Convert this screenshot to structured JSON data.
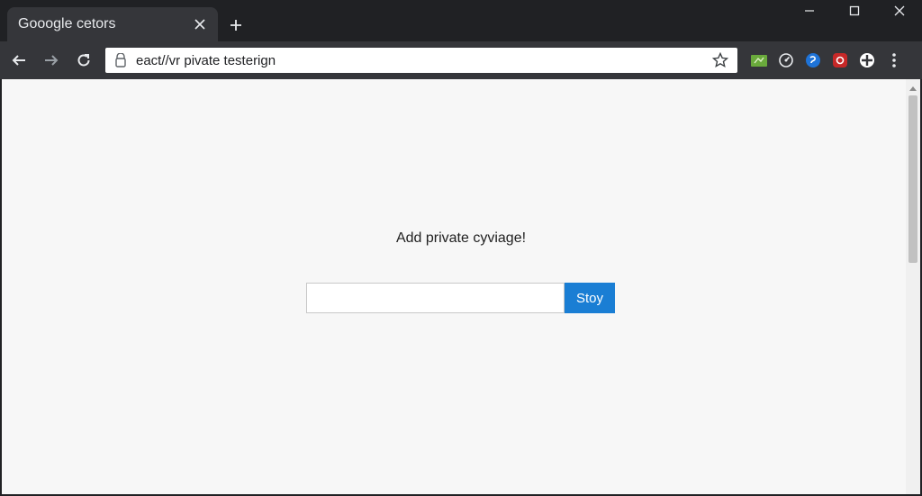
{
  "browser": {
    "tab": {
      "title": "Gooogle cetors"
    },
    "address_bar": {
      "url": "eact//vr pivate testerign"
    }
  },
  "page": {
    "heading": "Add private cyviage!",
    "input": {
      "value": "",
      "placeholder": ""
    },
    "submit_label": "Stoy"
  },
  "icons": {
    "tab_close": "close-icon",
    "new_tab": "plus-icon",
    "minimize": "minimize-icon",
    "maximize": "maximize-icon",
    "close": "close-icon",
    "back": "arrow-left-icon",
    "forward": "arrow-right-icon",
    "reload": "reload-icon",
    "lock": "page-info-icon",
    "bookmark": "star-icon",
    "menu": "kebab-menu-icon"
  },
  "colors": {
    "accent": "#1a7ed4",
    "chrome_dark": "#202124",
    "toolbar": "#35363a",
    "page_bg": "#f7f7f7"
  }
}
